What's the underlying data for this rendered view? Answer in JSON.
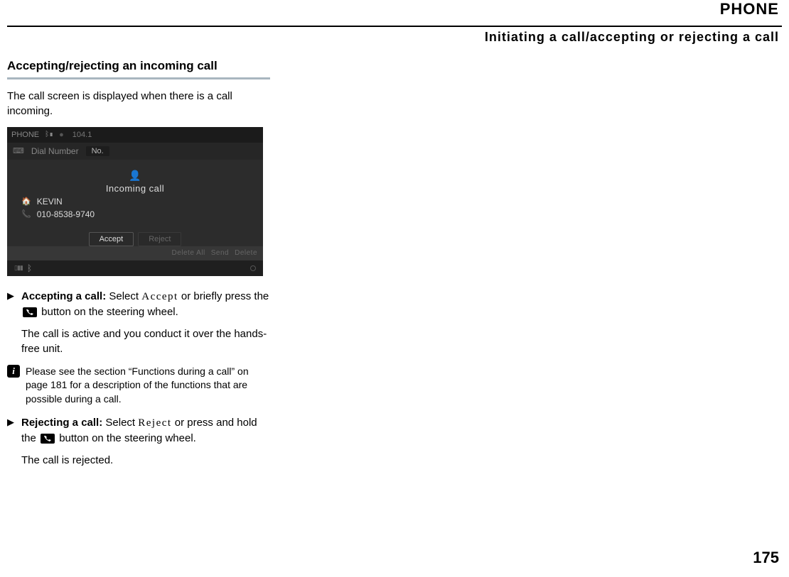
{
  "header": {
    "chapter": "PHONE",
    "section": "Initiating a call/accepting or rejecting a call"
  },
  "title": "Accepting/rejecting an incoming call",
  "intro": "The call screen is displayed when there is a call incoming.",
  "screen": {
    "top_label": "PHONE",
    "top_freq": "104.1",
    "dial_label": "Dial Number",
    "dial_field": "No.",
    "incoming_label": "Incoming call",
    "caller_name": "KEVIN",
    "caller_number": "010-8538-9740",
    "accept_btn": "Accept",
    "reject_btn": "Reject",
    "footer_a": "Delete All",
    "footer_b": "Send",
    "footer_c": "Delete"
  },
  "step_accept": {
    "label": "Accepting a call:",
    "pre": " Select ",
    "keyword": "Accept",
    "post1": " or briefly press the ",
    "post2": " button on the steering wheel.",
    "result": "The call is active and you conduct it over the hands-free unit."
  },
  "info_note": "Please see the section “Functions during a call” on page 181 for a description of the functions that are possible during a call.",
  "step_reject": {
    "label": "Rejecting a call:",
    "pre": " Select ",
    "keyword": "Reject",
    "post1": " or press and hold the ",
    "post2": " button on the steering wheel.",
    "result": "The call is rejected."
  },
  "page_number": "175"
}
